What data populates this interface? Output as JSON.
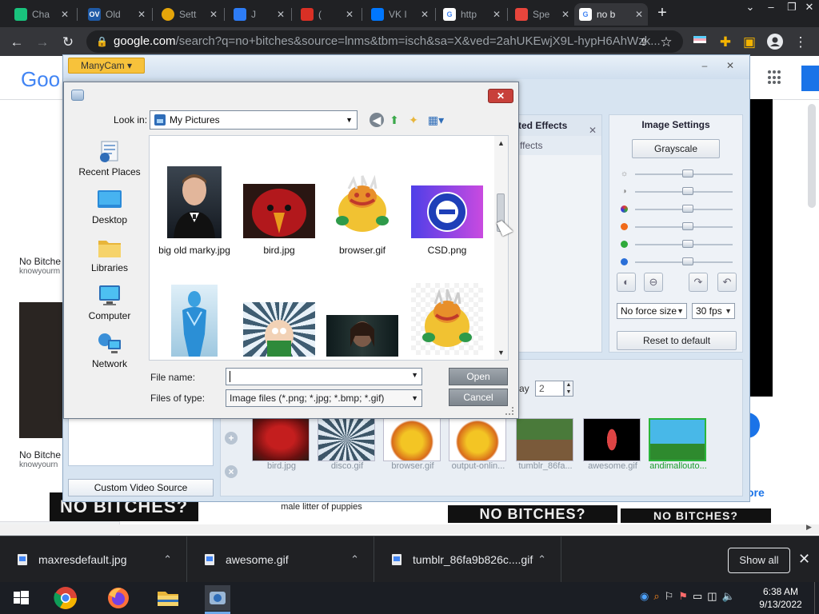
{
  "browser": {
    "tabs": [
      {
        "label": "Cha",
        "favicon": "chatgpt-icon",
        "color": "#19c37d"
      },
      {
        "label": "Old",
        "favicon": "ov-icon",
        "color": "#1f5aa6",
        "badge": "OV"
      },
      {
        "label": "Sett",
        "favicon": "gear-icon",
        "color": "#e5a50a"
      },
      {
        "label": "J",
        "favicon": "j-icon",
        "color": "#2d7cf6"
      },
      {
        "label": "(",
        "favicon": "mail-icon",
        "color": "#d93025"
      },
      {
        "label": "VK I",
        "favicon": "vk-icon",
        "color": "#0077ff"
      },
      {
        "label": "http",
        "favicon": "google-icon",
        "color": "#4285f4"
      },
      {
        "label": "Spe",
        "favicon": "speed-icon",
        "color": "#e8453c"
      },
      {
        "label": "no b",
        "favicon": "google-icon",
        "color": "#4285f4"
      }
    ],
    "url_host": "google.com",
    "url_rest": "/search?q=no+bitches&source=lnms&tbm=isch&sa=X&ved=2ahUKEwjX9L-hypH6AhWzk..."
  },
  "google": {
    "logo": "Goo",
    "results": [
      {
        "title": "No Bitche",
        "site": "knowyourm"
      },
      {
        "title": "No Bitche",
        "site": "knowyourn"
      }
    ],
    "more_label": "ore",
    "meme1": "NO BITCHES?",
    "meme2": "NO BITCHES?",
    "meme3": "NO BITCHES?",
    "puppies": "male litter of puppies",
    "status_url": "https://www.google.com/#"
  },
  "manycam": {
    "menu_label": "ManyCam ▾",
    "effects_title": "ted Effects",
    "effects_row": "ffects",
    "image_settings_title": "Image Settings",
    "grayscale_label": "Grayscale",
    "force_size": "No force size",
    "fps": "30 fps",
    "reset_label": "Reset to default",
    "custom_video_label": "Custom Video Source",
    "delay_label": "ay",
    "delay_value": "2",
    "slider_values": [
      0.55,
      0.55,
      0.55,
      0.55,
      0.55,
      0.55
    ],
    "strip": [
      {
        "name": "bird.jpg"
      },
      {
        "name": "disco.gif"
      },
      {
        "name": "browser.gif"
      },
      {
        "name": "output-onlin..."
      },
      {
        "name": "tumblr_86fa..."
      },
      {
        "name": "awesome.gif"
      },
      {
        "name": "andimallouto..."
      }
    ]
  },
  "dialog": {
    "look_in_label": "Look in:",
    "look_in_value": "My Pictures",
    "places": [
      "Recent Places",
      "Desktop",
      "Libraries",
      "Computer",
      "Network"
    ],
    "files": [
      {
        "name": "big old marky.jpg"
      },
      {
        "name": "bird.jpg"
      },
      {
        "name": "browser.gif"
      },
      {
        "name": "CSD.png"
      }
    ],
    "file_name_label": "File name:",
    "file_name_value": "",
    "files_of_type_label": "Files of type:",
    "files_of_type_value": "Image files (*.png; *.jpg; *.bmp; *.gif)",
    "open_label": "Open",
    "cancel_label": "Cancel"
  },
  "downloads": {
    "items": [
      {
        "name": "maxresdefault.jpg"
      },
      {
        "name": "awesome.gif"
      },
      {
        "name": "tumblr_86fa9b826c....gif"
      }
    ],
    "show_all": "Show all"
  },
  "taskbar": {
    "time": "6:38 AM",
    "date": "9/13/2022"
  }
}
